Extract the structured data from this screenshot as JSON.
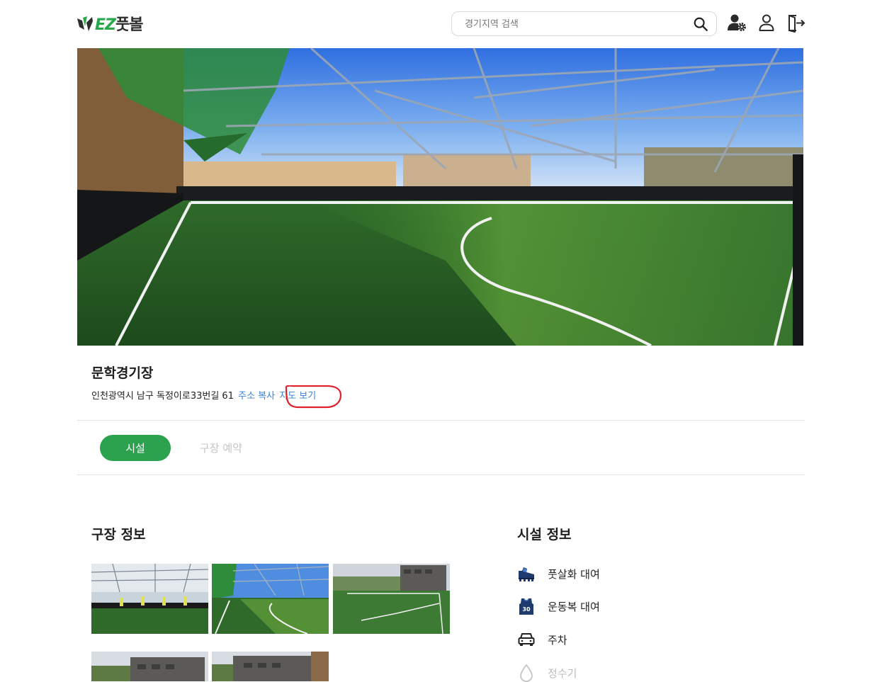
{
  "header": {
    "logo_ez": "EZ",
    "logo_kr": "풋볼",
    "search_placeholder": "경기지역 검색"
  },
  "venue": {
    "name": "문학경기장",
    "address": "인천광역시 남구 독정이로33번길 61",
    "copy_address": "주소 복사",
    "view_map": "지도 보기"
  },
  "tabs": [
    {
      "label": "시설",
      "active": true
    },
    {
      "label": "구장 예약",
      "active": false
    }
  ],
  "stadium_info": {
    "title": "구장 정보",
    "photo_count": 5
  },
  "facility_info": {
    "title": "시설 정보",
    "items": [
      {
        "label": "풋살화 대여",
        "icon": "futsal-shoe-icon",
        "available": true
      },
      {
        "label": "운동복 대여",
        "icon": "jersey-icon",
        "available": true
      },
      {
        "label": "주차",
        "icon": "car-icon",
        "available": true
      },
      {
        "label": "정수기",
        "icon": "water-drop-icon",
        "available": false
      }
    ]
  },
  "colors": {
    "brand_green": "#2ca24f",
    "link_blue": "#3a82d8",
    "annotation_red": "#e0202a",
    "disabled_gray": "#c4c4c4"
  }
}
